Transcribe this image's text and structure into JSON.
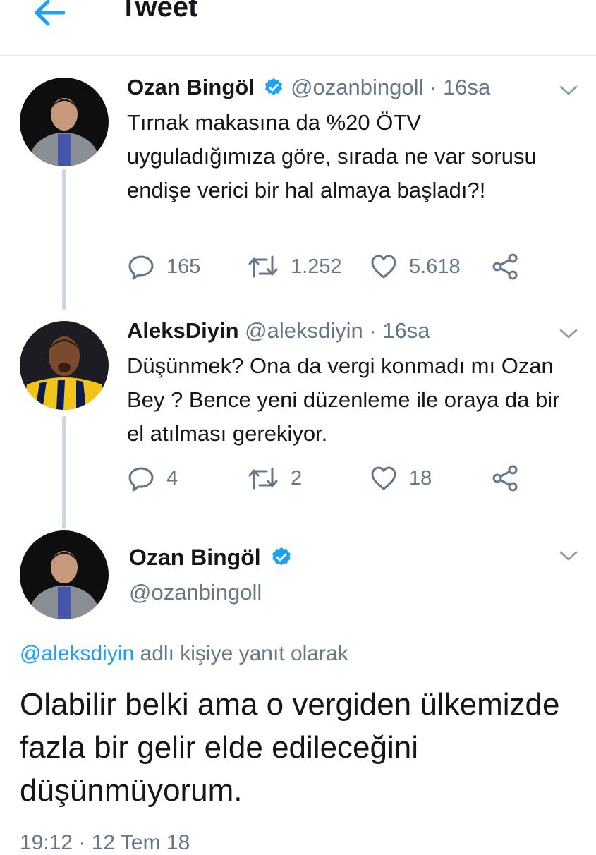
{
  "header": {
    "title": "Tweet",
    "back_icon": "back-arrow-icon"
  },
  "colors": {
    "accent": "#1da1f2",
    "text": "#14171a",
    "secondary": "#657786",
    "divider": "#e1e8ed",
    "thread_line": "#ccd6dd"
  },
  "tweets": [
    {
      "name": "Ozan Bingöl",
      "verified": true,
      "handle": "@ozanbingoll",
      "time": "· 16sa",
      "text": "Tırnak makasına da %20 ÖTV uyguladığımıza göre, sırada ne var sorusu endişe verici bir hal almaya başladı?!",
      "replies": "165",
      "retweets": "1.252",
      "likes": "5.618"
    },
    {
      "name": "AleksDiyin",
      "verified": false,
      "handle": "@aleksdiyin",
      "time": "· 16sa",
      "text": "Düşünmek? Ona da vergi konmadı mı Ozan Bey ? Bence yeni düzenleme ile oraya da bir el atılması gerekiyor.",
      "replies": "4",
      "retweets": "2",
      "likes": "18"
    }
  ],
  "main_tweet": {
    "name": "Ozan Bingöl",
    "verified": true,
    "handle": "@ozanbingoll",
    "reply_to_mention": "@aleksdiyin",
    "reply_to_suffix": "adlı kişiye yanıt olarak",
    "text": "Olabilir belki ama o vergiden ülkemizde fazla bir gelir elde edileceğini düşünmüyorum.",
    "timestamp": "19:12 · 12 Tem 18"
  },
  "icons": [
    "reply-icon",
    "retweet-icon",
    "like-icon",
    "share-icon",
    "chevron-down-icon",
    "verified-badge-icon"
  ]
}
